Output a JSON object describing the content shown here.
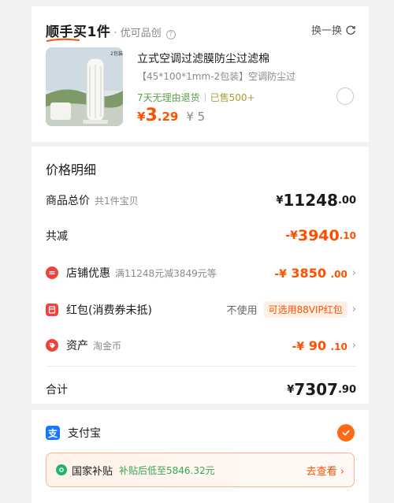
{
  "product_card": {
    "brand": "顺手买1件",
    "brand_sub": "· 优可品创",
    "help_icon": "?",
    "swap_label": "换一换",
    "thumb_badge": "2包装",
    "title": "立式空调过滤膜防尘过滤棉",
    "spec": "【45*100*1mm-2包装】空调防尘过",
    "return_policy": "7天无理由退货",
    "sold": "已售500+",
    "price_symbol": "¥",
    "price_int": "3",
    "price_dec": ".29",
    "orig_price": "¥ 5"
  },
  "price_detail": {
    "title": "价格明细",
    "total": {
      "label": "商品总价",
      "sub": "共1件宝贝",
      "symbol": "¥",
      "int": "11248",
      "dec": ".00"
    },
    "reduce": {
      "label": "共减",
      "symbol": "-¥",
      "int": "3940",
      "dec": ".10"
    },
    "store_discount": {
      "label": "店铺优惠",
      "sub": "满11248元减3849元等",
      "symbol": "-¥",
      "int": "3850",
      "dec": ".00"
    },
    "red_packet": {
      "label": "红包(消费券未抵)",
      "status": "不使用",
      "chip": "可选用88VIP红包"
    },
    "assets": {
      "label": "资产",
      "sub": "淘金币",
      "symbol": "-¥",
      "int": "90",
      "dec": ".10"
    },
    "sum": {
      "label": "合计",
      "symbol": "¥",
      "int": "7307",
      "dec": ".90"
    }
  },
  "payment": {
    "method_icon": "支",
    "method": "支付宝",
    "subsidy_title": "国家补贴",
    "subsidy_desc": "补贴后低至5846.32元",
    "subsidy_link": "去查看",
    "chevron": "›"
  },
  "colors": {
    "accent": "#ff5000",
    "green": "#5aa34c",
    "alipay": "#1677ff",
    "check": "#ff6a13"
  }
}
